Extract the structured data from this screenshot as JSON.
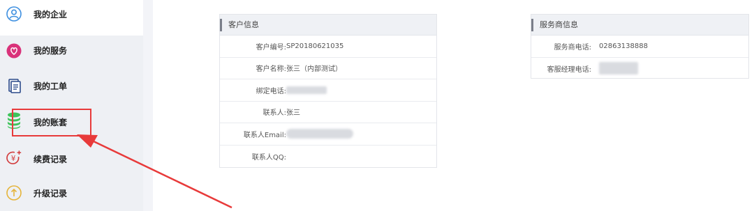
{
  "sidebar": {
    "items": [
      {
        "label": "我的企业",
        "icon": "user-circle-icon",
        "active": true
      },
      {
        "label": "我的服务",
        "icon": "heart-badge-icon"
      },
      {
        "label": "我的工单",
        "icon": "document-icon"
      },
      {
        "label": "我的账套",
        "icon": "database-stack-icon"
      },
      {
        "label": "续费记录",
        "icon": "yen-renew-icon"
      },
      {
        "label": "升级记录",
        "icon": "upgrade-arrow-icon"
      }
    ]
  },
  "customer_panel": {
    "title": "客户信息",
    "rows": [
      {
        "label": "客户编号:",
        "value": "SP20180621035"
      },
      {
        "label": "客户名称:",
        "value": "张三（内部测试）"
      },
      {
        "label": "绑定电话:",
        "value": ""
      },
      {
        "label": "联系人:",
        "value": "张三"
      },
      {
        "label": "联系人Email:",
        "value": ""
      },
      {
        "label": "联系人QQ:",
        "value": ""
      }
    ]
  },
  "provider_panel": {
    "title": "服务商信息",
    "rows": [
      {
        "label": "服务商电话:",
        "value": "02863138888"
      },
      {
        "label": "客服经理电话:",
        "value": ""
      }
    ]
  },
  "colors": {
    "sidebar_bg": "#eef0f4",
    "annotation_red": "#e83a3a"
  }
}
